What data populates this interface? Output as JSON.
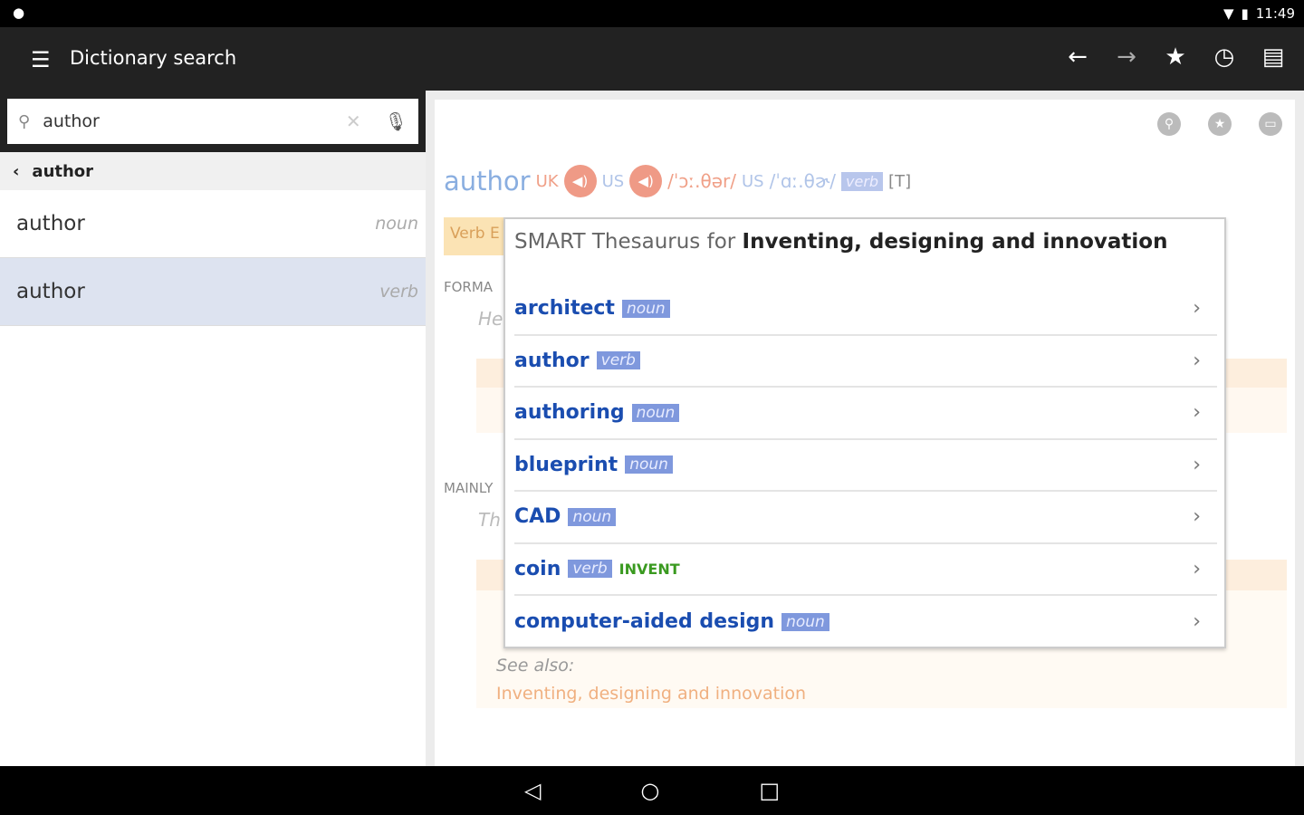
{
  "status": {
    "time": "11:49",
    "icons": [
      "location-pin-icon",
      "wifi-icon",
      "battery-icon"
    ]
  },
  "appbar": {
    "title": "Dictionary search",
    "actions": [
      "back-arrow-icon",
      "forward-arrow-icon",
      "star-icon",
      "history-icon",
      "clipboard-icon"
    ]
  },
  "search": {
    "value": "author"
  },
  "breadcrumb": "author",
  "results": [
    {
      "word": "author",
      "pos": "noun"
    },
    {
      "word": "author",
      "pos": "verb",
      "selected": true
    }
  ],
  "entry": {
    "headword": "author",
    "uk": "UK",
    "us": "US",
    "ipa_uk": "/ˈɔː.θər/",
    "us2": "US",
    "ipa_us": "/ˈɑː.θɚ/",
    "pos": "verb",
    "grammar": "[T]"
  },
  "background": {
    "verb_tab": "Verb E",
    "forma": "FORMA",
    "he": "He",
    "mainly": "MAINLY",
    "th": "Th",
    "see_also": "See also:",
    "see_also_link": "Inventing, designing and innovation"
  },
  "thesaurus": {
    "prefix": "SMART Thesaurus for",
    "topic": "Inventing, designing and innovation",
    "items": [
      {
        "word": "architect",
        "pos": "noun",
        "label": ""
      },
      {
        "word": "author",
        "pos": "verb",
        "label": ""
      },
      {
        "word": "authoring",
        "pos": "noun",
        "label": ""
      },
      {
        "word": "blueprint",
        "pos": "noun",
        "label": ""
      },
      {
        "word": "CAD",
        "pos": "noun",
        "label": ""
      },
      {
        "word": "coin",
        "pos": "verb",
        "label": "INVENT"
      },
      {
        "word": "computer-aided design",
        "pos": "noun",
        "label": ""
      }
    ]
  },
  "colors": {
    "link": "#1a4db0",
    "pos_tag": "#7f98dd",
    "accent_orange": "#ef9a86"
  }
}
